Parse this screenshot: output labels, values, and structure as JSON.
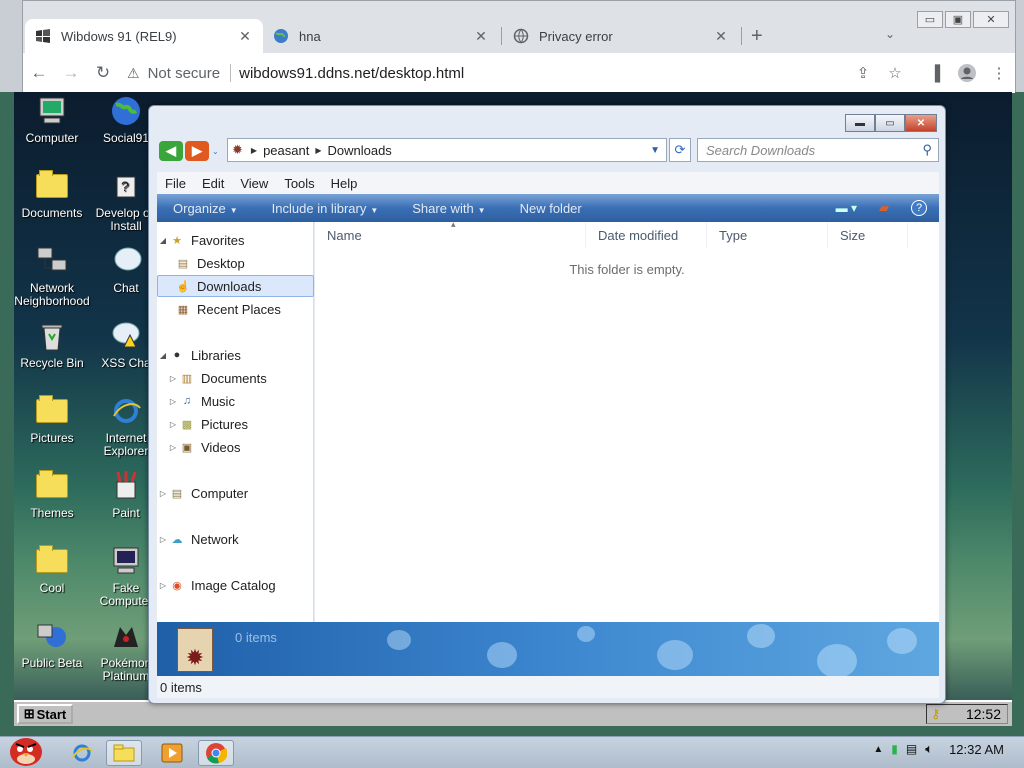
{
  "browser": {
    "tabs": [
      {
        "title": "Wibdows 91 (REL9)",
        "active": true
      },
      {
        "title": "hna",
        "active": false
      },
      {
        "title": "Privacy error",
        "active": false
      }
    ],
    "not_secure": "Not secure",
    "url": "wibdows91.ddns.net/desktop.html"
  },
  "desktop": {
    "icons": [
      {
        "label": "Computer"
      },
      {
        "label": "Social91"
      },
      {
        "label": "Documents"
      },
      {
        "label": "Develop on Install"
      },
      {
        "label": "Network Neighborhood"
      },
      {
        "label": "Chat"
      },
      {
        "label": "Recycle Bin"
      },
      {
        "label": "XSS Cha"
      },
      {
        "label": "Pictures"
      },
      {
        "label": "Internet Explorer"
      },
      {
        "label": "Themes"
      },
      {
        "label": "Paint"
      },
      {
        "label": "Cool"
      },
      {
        "label": "Fake Computer"
      },
      {
        "label": "Public Beta"
      },
      {
        "label": "Pokémon Platinum"
      }
    ]
  },
  "explorer": {
    "breadcrumb": [
      "peasant",
      "Downloads"
    ],
    "search_placeholder": "Search Downloads",
    "menu": [
      "File",
      "Edit",
      "View",
      "Tools",
      "Help"
    ],
    "commands": {
      "organize": "Organize",
      "include": "Include in library",
      "share": "Share with",
      "newfolder": "New folder"
    },
    "nav": {
      "favorites": "Favorites",
      "desktop": "Desktop",
      "downloads": "Downloads",
      "recent": "Recent Places",
      "libraries": "Libraries",
      "lib_documents": "Documents",
      "lib_music": "Music",
      "lib_pictures": "Pictures",
      "lib_videos": "Videos",
      "computer": "Computer",
      "network": "Network",
      "image_catalog": "Image Catalog"
    },
    "columns": {
      "name": "Name",
      "date": "Date modified",
      "type": "Type",
      "size": "Size"
    },
    "empty_text": "This folder is empty.",
    "details_count": "0 items",
    "status": "0 items"
  },
  "win98": {
    "start": "Start",
    "clock": "12:52"
  },
  "host": {
    "clock": "12:32 AM"
  },
  "colors": {
    "accent": "#2e5f9f",
    "close_red": "#c4412a",
    "folder": "#f6de5a"
  }
}
